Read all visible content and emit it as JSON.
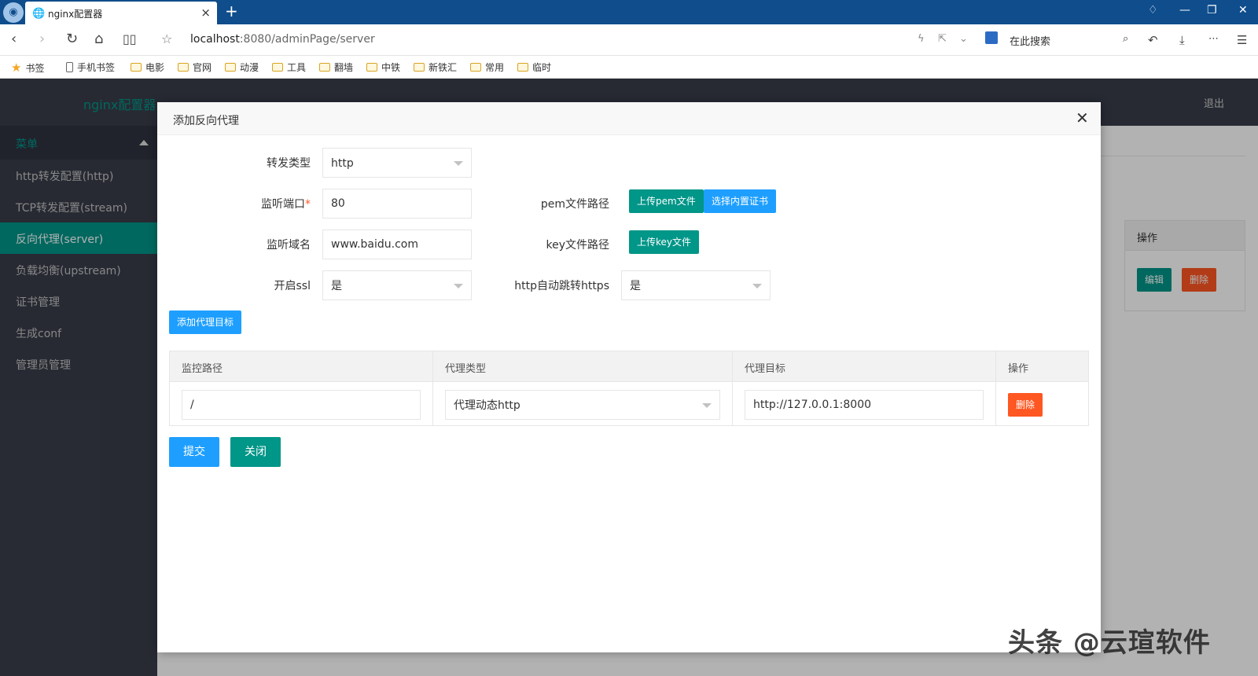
{
  "browser": {
    "tab_title": "nginx配置器",
    "url_host": "localhost",
    "url_path": ":8080/adminPage/server",
    "search_placeholder": "在此搜索"
  },
  "bookmarks": [
    "书签",
    "手机书签",
    "电影",
    "官网",
    "动漫",
    "工具",
    "翻墙",
    "中铁",
    "新铁汇",
    "常用",
    "临时"
  ],
  "app": {
    "brand": "nginx配置器",
    "logout": "退出",
    "menu_title": "菜单",
    "menu": [
      {
        "label": "http转发配置(http)"
      },
      {
        "label": "TCP转发配置(stream)"
      },
      {
        "label": "反向代理(server)"
      },
      {
        "label": "负载均衡(upstream)"
      },
      {
        "label": "证书管理"
      },
      {
        "label": "生成conf"
      },
      {
        "label": "管理员管理"
      }
    ],
    "active_menu": "反向代理(server)"
  },
  "background_table": {
    "header": "操作",
    "edit": "编辑",
    "delete": "删除"
  },
  "modal": {
    "title": "添加反向代理",
    "forward_type_label": "转发类型",
    "forward_type_value": "http",
    "port_label": "监听端口",
    "port_required_mark": "*",
    "port_value": "80",
    "domain_label": "监听域名",
    "domain_value": "www.baidu.com",
    "ssl_label": "开启ssl",
    "ssl_value": "是",
    "pem_label": "pem文件路径",
    "upload_pem": "上传pem文件",
    "choose_cert": "选择内置证书",
    "key_label": "key文件路径",
    "upload_key": "上传key文件",
    "https_redirect_label": "http自动跳转https",
    "https_redirect_value": "是",
    "add_target": "添加代理目标",
    "table_headers": [
      "监控路径",
      "代理类型",
      "代理目标",
      "操作"
    ],
    "rows": [
      {
        "path": "/",
        "type": "代理动态http",
        "target": "http://127.0.0.1:8000",
        "action": "删除"
      }
    ],
    "submit": "提交",
    "close": "关闭"
  },
  "watermark": "头条 @云瑄软件",
  "colors": {
    "primary_teal": "#009688",
    "normal_blue": "#1e9fff",
    "danger_orange": "#ff5722",
    "sidebar_bg": "#393d49",
    "browser_bar": "#0f4d8c"
  }
}
